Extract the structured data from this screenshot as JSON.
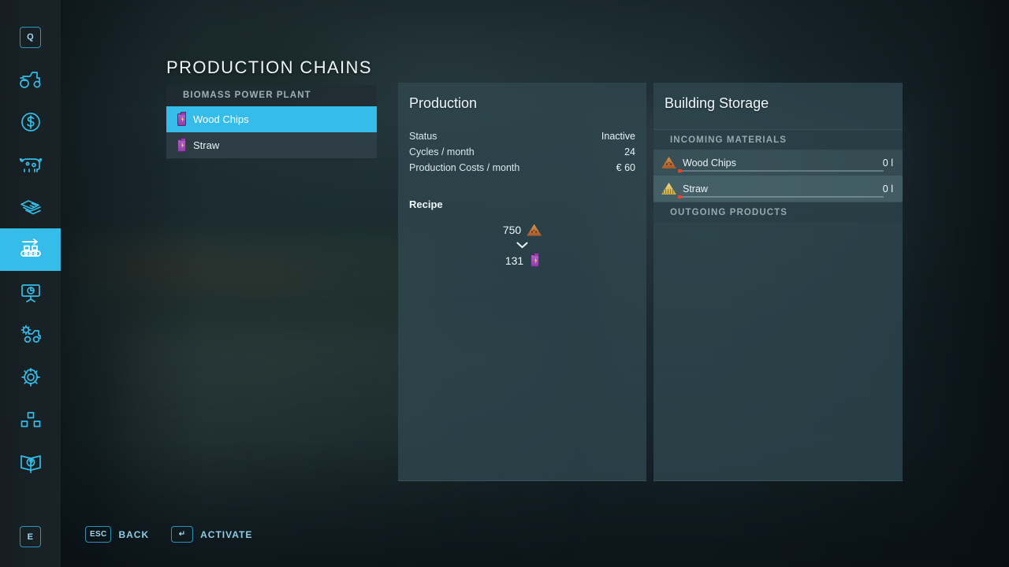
{
  "page": {
    "title": "PRODUCTION CHAINS"
  },
  "theme": {
    "accent": "#35bce8",
    "panel_bg": "#2f4850",
    "text": "#eef5f8",
    "muted": "#96a9b0",
    "warning": "#e3452f"
  },
  "sidebar": {
    "items": [
      {
        "name": "quick-menu",
        "icon": "q-key-icon",
        "label": "Q",
        "active": false
      },
      {
        "name": "vehicles",
        "icon": "tractor-icon",
        "label": "Vehicles",
        "active": false
      },
      {
        "name": "finances",
        "icon": "dollar-coin-icon",
        "label": "Finances",
        "active": false
      },
      {
        "name": "animals",
        "icon": "cow-icon",
        "label": "Animals",
        "active": false
      },
      {
        "name": "contracts",
        "icon": "documents-icon",
        "label": "Contracts",
        "active": false
      },
      {
        "name": "production",
        "icon": "conveyor-belt-icon",
        "label": "Production Chains",
        "active": true
      },
      {
        "name": "statistics",
        "icon": "chart-board-icon",
        "label": "Statistics",
        "active": false
      },
      {
        "name": "vehicle-settings",
        "icon": "tractor-gear-icon",
        "label": "Vehicle Settings",
        "active": false
      },
      {
        "name": "settings",
        "icon": "gear-icon",
        "label": "Settings",
        "active": false
      },
      {
        "name": "multiplayer",
        "icon": "blocks-network-icon",
        "label": "Multiplayer",
        "active": false
      },
      {
        "name": "help",
        "icon": "help-book-icon",
        "label": "Help",
        "active": false
      }
    ],
    "bottom_key": "E"
  },
  "chain_list": {
    "header": "BIOMASS POWER PLANT",
    "rows": [
      {
        "label": "Wood Chips",
        "icon": "electricity-battery-icon",
        "selected": true
      },
      {
        "label": "Straw",
        "icon": "electricity-battery-icon",
        "selected": false
      }
    ]
  },
  "production": {
    "title": "Production",
    "stats": [
      {
        "key": "Status",
        "value": "Inactive"
      },
      {
        "key": "Cycles / month",
        "value": "24"
      },
      {
        "key": "Production Costs / month",
        "value": "€ 60"
      }
    ],
    "recipe_title": "Recipe",
    "recipe": {
      "input": {
        "amount": "750",
        "icon": "wood-chips-pile-icon"
      },
      "arrow": "chevron-down-icon",
      "output": {
        "amount": "131",
        "icon": "electricity-battery-icon"
      }
    }
  },
  "storage": {
    "title": "Building Storage",
    "incoming_header": "INCOMING MATERIALS",
    "outgoing_header": "OUTGOING PRODUCTS",
    "incoming": [
      {
        "label": "Wood Chips",
        "amount": "0 l",
        "icon": "wood-chips-pile-icon",
        "fill_percent": 0,
        "highlighted": false
      },
      {
        "label": "Straw",
        "amount": "0 l",
        "icon": "straw-pile-icon",
        "fill_percent": 0,
        "highlighted": true
      }
    ],
    "outgoing": []
  },
  "footer": {
    "hints": [
      {
        "key": "ESC",
        "label": "BACK",
        "name": "back-hint"
      },
      {
        "key": "↵",
        "label": "ACTIVATE",
        "name": "activate-hint"
      }
    ]
  }
}
